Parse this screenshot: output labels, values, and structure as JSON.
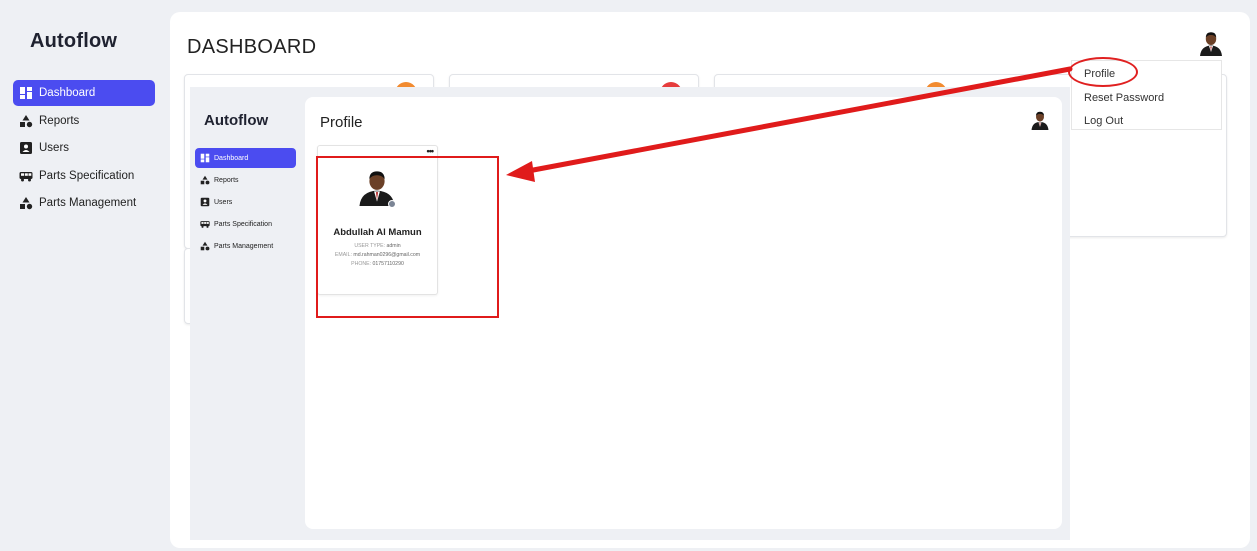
{
  "app": {
    "brand": "Autoflow",
    "page_title": "DASHBOARD",
    "nav": [
      {
        "label": "Dashboard",
        "icon": "dashboard-icon",
        "active": true
      },
      {
        "label": "Reports",
        "icon": "shapes-icon",
        "active": false
      },
      {
        "label": "Users",
        "icon": "user-card-icon",
        "active": false
      },
      {
        "label": "Parts Specification",
        "icon": "bus-icon",
        "active": false
      },
      {
        "label": "Parts Management",
        "icon": "shapes-icon",
        "active": false
      }
    ],
    "user_menu": {
      "items": [
        "Profile",
        "Reset Password",
        "Log Out"
      ]
    }
  },
  "inset": {
    "brand": "Autoflow",
    "page_title": "Profile",
    "nav": [
      {
        "label": "Dashboard",
        "active": true
      },
      {
        "label": "Reports",
        "active": false
      },
      {
        "label": "Users",
        "active": false
      },
      {
        "label": "Parts Specification",
        "active": false
      },
      {
        "label": "Parts Management",
        "active": false
      }
    ],
    "profile": {
      "menu": "•••",
      "name": "Abdullah Al Mamun",
      "user_type_label": "USER TYPE:",
      "user_type": "admin",
      "email_label": "EMAIL:",
      "email": "md.rahman0296@gmail.com",
      "phone_label": "PHONE:",
      "phone": "01757110290"
    }
  },
  "colors": {
    "accent": "#4b4cf0",
    "annotation": "#e01b1b",
    "orange": "#f28b30"
  }
}
